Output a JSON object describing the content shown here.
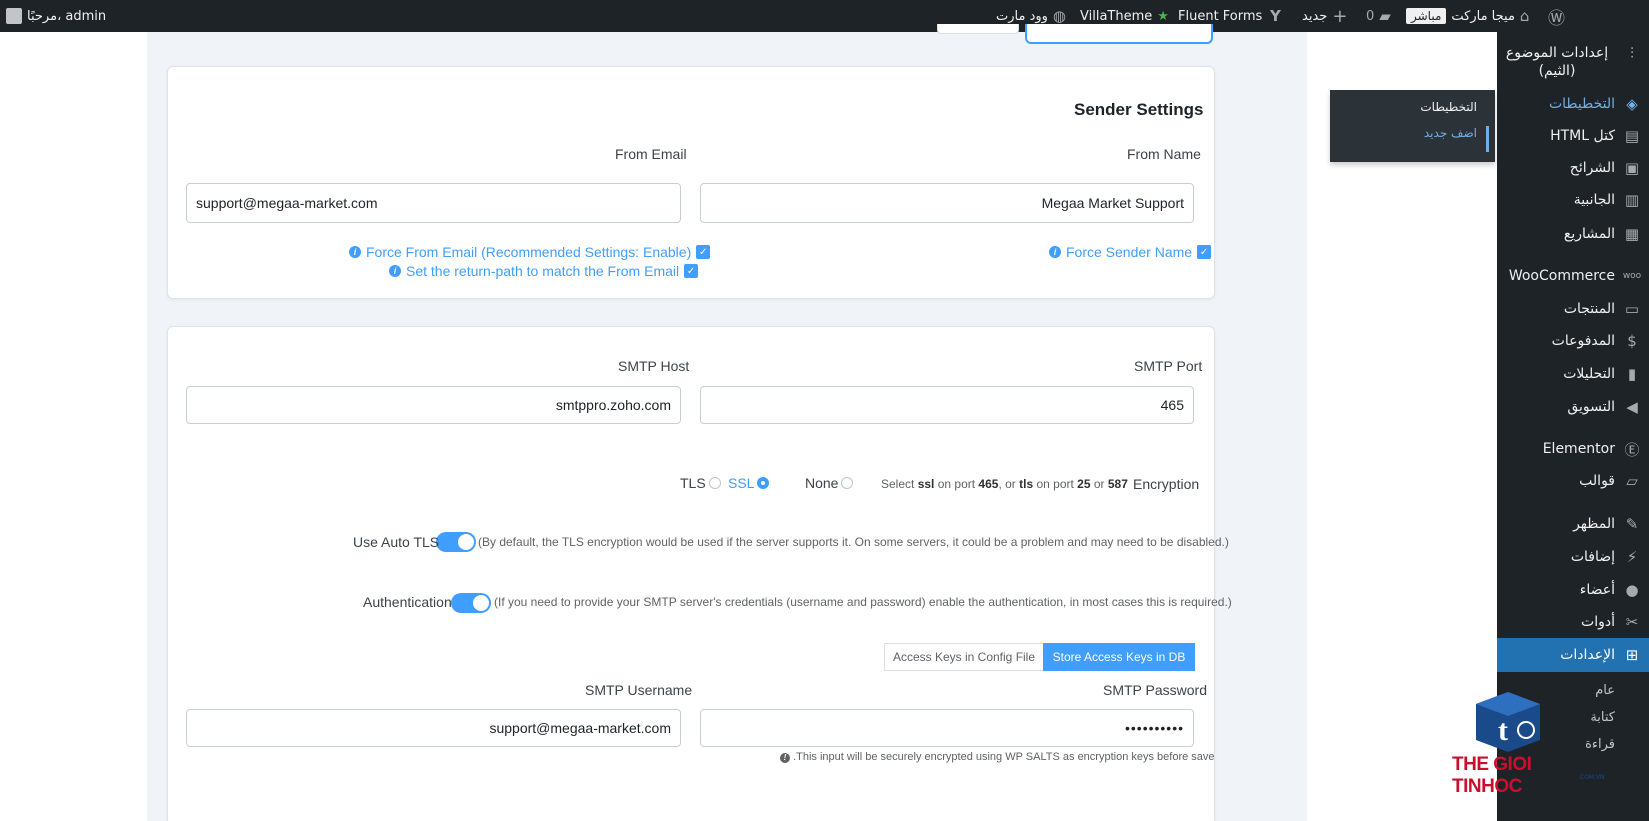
{
  "adminbar": {
    "greeting": "مرحبًا، admin",
    "site_name": "ميجا ماركت",
    "live_badge": "مباشر",
    "comments_count": "0",
    "new_label": "جديد",
    "fluent_forms": "Fluent Forms",
    "villatheme": "VillaTheme",
    "woodmart": "وود مارت"
  },
  "sidebar": {
    "items": [
      {
        "label": "إعدادات الموضوع (الثيم)",
        "icon": "sliders-icon"
      },
      {
        "label": "التخطيطات",
        "icon": "layers-icon"
      },
      {
        "label": "كتل HTML",
        "icon": "code-icon"
      },
      {
        "label": "الشرائح",
        "icon": "slides-icon"
      },
      {
        "label": "الجانبية",
        "icon": "sidebar-icon"
      },
      {
        "label": "المشاريع",
        "icon": "briefcase-icon"
      },
      {
        "label": "WooCommerce",
        "icon": "woo-icon"
      },
      {
        "label": "المنتجات",
        "icon": "archive-icon"
      },
      {
        "label": "المدفوعات",
        "icon": "dollar-icon"
      },
      {
        "label": "التحليلات",
        "icon": "bar-chart-icon"
      },
      {
        "label": "التسويق",
        "icon": "megaphone-icon"
      },
      {
        "label": "Elementor",
        "icon": "elementor-icon"
      },
      {
        "label": "قوالب",
        "icon": "folder-icon"
      },
      {
        "label": "المظهر",
        "icon": "brush-icon"
      },
      {
        "label": "إضافات",
        "icon": "plugin-icon"
      },
      {
        "label": "أعضاء",
        "icon": "user-icon"
      },
      {
        "label": "أدوات",
        "icon": "wrench-icon"
      },
      {
        "label": "الإعدادات",
        "icon": "settings-icon"
      }
    ],
    "sub_items": [
      "عام",
      "كتابة",
      "قراءة"
    ]
  },
  "flyout": {
    "items": [
      "التخطيطات",
      "اضف جديد"
    ]
  },
  "sender": {
    "title": "Sender Settings",
    "from_email_label": "From Email",
    "from_name_label": "From Name",
    "from_email_value": "support@megaa-market.com",
    "from_name_value": "Megaa Market Support",
    "force_from_email": "Force From Email (Recommended Settings: Enable)",
    "return_path": "Set the return-path to match the From Email",
    "force_sender_name": "Force Sender Name"
  },
  "smtp": {
    "host_label": "SMTP Host",
    "port_label": "SMTP Port",
    "host_value": "smtppro.zoho.com",
    "port_value": "465",
    "encryption_label": "Encryption",
    "encryption_hint": {
      "p1": "Select ",
      "ssl": "ssl",
      "p2": " on port ",
      "port465": "465",
      "p3": ", or ",
      "tls": "tls",
      "p4": " on port ",
      "port25": "25",
      "p5": " or ",
      "port587": "587"
    },
    "enc_options": {
      "none": "None",
      "ssl": "SSL",
      "tls": "TLS"
    },
    "enc_selected": "SSL",
    "auto_tls_label": "Use Auto TLS",
    "auto_tls_hint": "(By default, the TLS encryption would be used if the server supports it. On some servers, it could be a problem and may need to be disabled.)",
    "auth_label": "Authentication",
    "auth_hint": "(If you need to provide your SMTP server's credentials (username and password) enable the authentication, in most cases this is required.)",
    "tab_db": "Store Access Keys in DB",
    "tab_config": "Access Keys in Config File",
    "username_label": "SMTP Username",
    "password_label": "SMTP Password",
    "username_value": "support@megaa-market.com",
    "password_value": "••••••••••",
    "password_hint": "This input will be securely encrypted using WP SALTS as encryption keys before save."
  },
  "logo": {
    "text": "THE GIOI TINHOC",
    "sub": ".COM.VN"
  }
}
